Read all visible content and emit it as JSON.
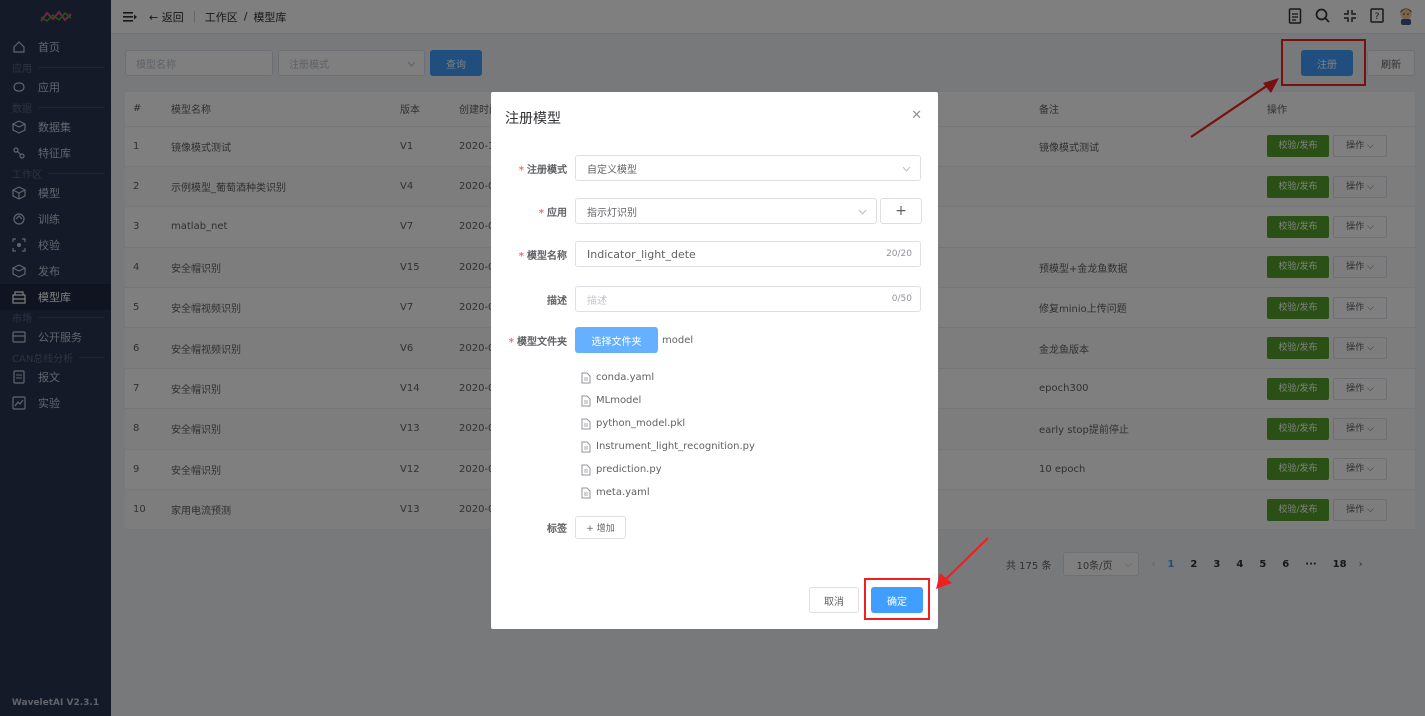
{
  "app": {
    "version": "WaveletAI V2.3.1"
  },
  "sidebar": {
    "items": [
      {
        "label": "首页",
        "icon": "home-icon"
      },
      {
        "section": "应用"
      },
      {
        "label": "应用",
        "icon": "app-icon"
      },
      {
        "section": "数据"
      },
      {
        "label": "数据集",
        "icon": "dataset-icon"
      },
      {
        "label": "特征库",
        "icon": "feature-icon"
      },
      {
        "section": "工作区"
      },
      {
        "label": "模型",
        "icon": "model-icon"
      },
      {
        "label": "训练",
        "icon": "train-icon"
      },
      {
        "label": "校验",
        "icon": "check-icon"
      },
      {
        "label": "发布",
        "icon": "publish-icon"
      },
      {
        "label": "模型库",
        "icon": "model-lib-icon",
        "active": true
      },
      {
        "section": "市场"
      },
      {
        "label": "公开服务",
        "icon": "service-icon"
      },
      {
        "section": "CAN总线分析"
      },
      {
        "label": "报文",
        "icon": "message-icon"
      },
      {
        "label": "实验",
        "icon": "experiment-icon"
      }
    ]
  },
  "topbar": {
    "back_label": "← 返回",
    "breadcrumb": [
      "工作区",
      "模型库"
    ],
    "breadcrumb_sep": "/"
  },
  "filters": {
    "name_placeholder": "模型名称",
    "mode_placeholder": "注册模式",
    "query_label": "查询",
    "register_label": "注册",
    "refresh_label": "刷新"
  },
  "table": {
    "columns": [
      "#",
      "模型名称",
      "版本",
      "创建时间",
      "备注",
      "操作"
    ],
    "rows": [
      {
        "idx": "1",
        "name": "镜像模式测试",
        "ver": "V1",
        "time": "2020-1",
        "note": "镜像模式测试"
      },
      {
        "idx": "2",
        "name": "示例模型_葡萄酒种类识别",
        "ver": "V4",
        "time": "2020-0",
        "note": ""
      },
      {
        "idx": "3",
        "name": "matlab_net",
        "ver": "V7",
        "time": "2020-0",
        "note": ""
      },
      {
        "idx": "4",
        "name": "安全帽识别",
        "ver": "V15",
        "time": "2020-0",
        "note": "预模型+金龙鱼数据"
      },
      {
        "idx": "5",
        "name": "安全帽视频识别",
        "ver": "V7",
        "time": "2020-0",
        "note": "修复minio上传问题"
      },
      {
        "idx": "6",
        "name": "安全帽视频识别",
        "ver": "V6",
        "time": "2020-0",
        "note": "金龙鱼版本"
      },
      {
        "idx": "7",
        "name": "安全帽识别",
        "ver": "V14",
        "time": "2020-0",
        "note": "epoch300"
      },
      {
        "idx": "8",
        "name": "安全帽识别",
        "ver": "V13",
        "time": "2020-0",
        "note": "early stop提前停止"
      },
      {
        "idx": "9",
        "name": "安全帽识别",
        "ver": "V12",
        "time": "2020-0",
        "note": "10 epoch"
      },
      {
        "idx": "10",
        "name": "家用电流预测",
        "ver": "V13",
        "time": "2020-0",
        "note": ""
      }
    ],
    "op_primary": "校验/发布",
    "op_more": "操作 ⌵"
  },
  "pagination": {
    "total": "共 175 条",
    "page_size": "10条/页",
    "pages": [
      "1",
      "2",
      "3",
      "4",
      "5",
      "6",
      "···",
      "18"
    ],
    "current": "1"
  },
  "dialog": {
    "title": "注册模型",
    "fields": {
      "mode_label": "注册模式",
      "mode_value": "自定义模型",
      "app_label": "应用",
      "app_value": "指示灯识别",
      "name_label": "模型名称",
      "name_value": "Indicator_light_dete",
      "name_count": "20/20",
      "desc_label": "描述",
      "desc_placeholder": "描述",
      "desc_count": "0/50",
      "folder_label": "模型文件夹",
      "folder_button": "选择文件夹",
      "folder_value": "model",
      "tags_label": "标签",
      "tags_add": "+ 增加"
    },
    "files": [
      "conda.yaml",
      "MLmodel",
      "python_model.pkl",
      "Instrument_light_recognition.py",
      "prediction.py",
      "meta.yaml"
    ],
    "cancel_label": "取消",
    "confirm_label": "确定"
  },
  "colors": {
    "primary": "#409eff",
    "sidebar": "#2b3550",
    "success": "#56a02c",
    "highlight": "#f02020"
  }
}
